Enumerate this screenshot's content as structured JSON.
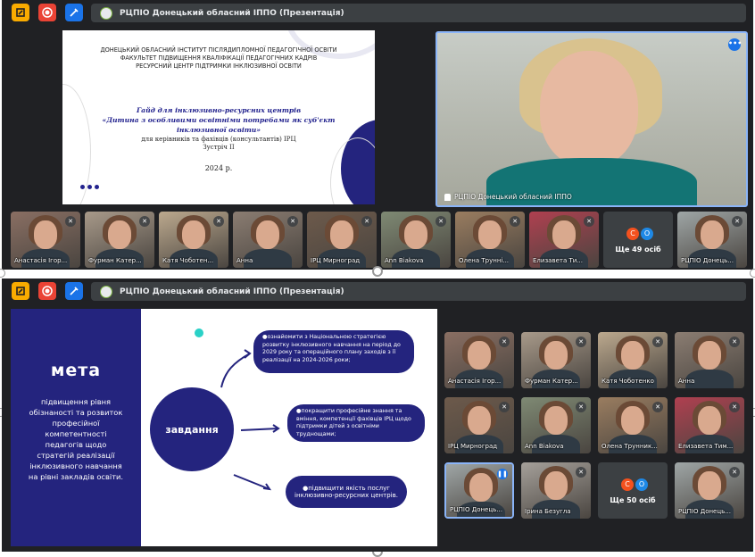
{
  "meeting_title": "РЦПІО Донецький обласний ІППО (Презентація)",
  "slide1": {
    "header": "ДОНЕЦЬКИЙ ОБЛАСНИЙ ІНСТИТУТ ПІСЛЯДИПЛОМНОЇ ПЕДАГОГІЧНОЇ ОСВІТИ\nФАКУЛЬТЕТ ПІДВИЩЕННЯ КВАЛІФІКАЦІЇ ПЕДАГОГІЧНИХ КАДРІВ\nРЕСУРСНИЙ ЦЕНТР ПІДТРИМКИ ІНКЛЮЗИВНОЇ ОСВІТИ",
    "title": "Гайд для інклюзивно-ресурсних центрів\n«Дитина з особливими освітніми потребами як суб'єкт інклюзивної освіти»",
    "subtitle": "для керівників та фахівців (консультантів) ІРЦ\nЗустріч ІІ",
    "year": "2024 р."
  },
  "speaker": {
    "name": "РЦПІО Донецький обласний ІППО"
  },
  "strip1": [
    {
      "name": "Анастасія Ігор...",
      "color": "#8a6f63"
    },
    {
      "name": "Фурман Катер...",
      "color": "#a89a8a"
    },
    {
      "name": "Катя Чоботен...",
      "color": "#bca98e"
    },
    {
      "name": "Анна",
      "color": "#8b7d72"
    },
    {
      "name": "ІРЦ Мирноград",
      "color": "#6d5a4b"
    },
    {
      "name": "Ann Biakova",
      "color": "#7f8a74"
    },
    {
      "name": "Олена Трунні...",
      "color": "#9a7d60"
    },
    {
      "name": "Елизавета Ти...",
      "color": "#b04050"
    },
    {
      "more": "Ще 49 осіб"
    },
    {
      "name": "РЦПІО Донець...",
      "color": "#9fa6a6"
    }
  ],
  "slide2": {
    "meta": "мета",
    "desc": "підвищення рівня обізнаності та розвиток професійної компетентності педагогів щодо стратегій реалізації інклюзивного навчання на рівні закладів освіти.",
    "center": "завдання",
    "task1": "●ознайомити з Національною стратегією розвитку інклюзивного навчання на період до 2029 року та операційного плану заходів з її реалізації на 2024-2026 роки;",
    "task2": "●покращити професійне знання та вміння, компетенції фахівців ІРЦ щодо підтримки дітей з освітніми труднощами;",
    "task3": "●підвищити якість послуг інклюзивно-ресурсних центрів."
  },
  "grid2": [
    {
      "name": "Анастасія Ігор...",
      "color": "#8a6f63"
    },
    {
      "name": "Фурман Катер...",
      "color": "#a89a8a"
    },
    {
      "name": "Катя Чоботенко",
      "color": "#bca98e"
    },
    {
      "name": "Анна",
      "color": "#8b7d72"
    },
    {
      "name": "ІРЦ Мирноград",
      "color": "#6d5a4b"
    },
    {
      "name": "Ann Biakova",
      "color": "#7f8a74"
    },
    {
      "name": "Олена Трунник...",
      "color": "#9a7d60"
    },
    {
      "name": "Елизавета Тим...",
      "color": "#b04050"
    },
    {
      "name": "РЦПІО Донець...",
      "color": "#9fa6a6",
      "active": true
    },
    {
      "name": "Ірина Безугла",
      "color": "#a5a09a"
    },
    {
      "more": "Ще 50 осіб"
    },
    {
      "name": "РЦПІО Донець...",
      "color": "#9fa6a6"
    }
  ],
  "avatars": [
    {
      "letter": "С",
      "color": "#f4511e"
    },
    {
      "letter": "О",
      "color": "#1e88e5"
    }
  ],
  "colors": {
    "accent": "#1a73e8",
    "slide_blue": "#24247e",
    "bg": "#202124"
  }
}
